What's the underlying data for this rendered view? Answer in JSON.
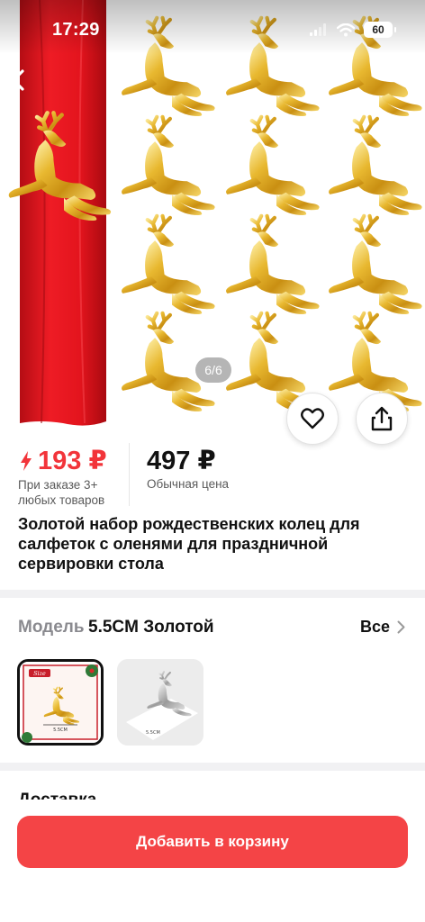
{
  "status_bar": {
    "time": "17:29",
    "battery": "60",
    "icons": [
      "signal-icon",
      "wifi-icon",
      "battery-icon"
    ]
  },
  "gallery": {
    "counter": "6/6",
    "image": "product-photo-golden-deer-napkin-rings",
    "actions": [
      "heart-icon",
      "share-icon"
    ]
  },
  "price": {
    "sale_price": "193 ₽",
    "sale_note_line1": "При заказе 3+",
    "sale_note_line2": "любых товаров",
    "regular_price": "497 ₽",
    "regular_note": "Обычная цена",
    "sale_color": "#f2343a"
  },
  "product": {
    "title": "Золотой набор рождественских колец для салфеток с оленями для праздничной сервировки стола"
  },
  "model": {
    "label": "Модель",
    "value": "5.5CM Золотой",
    "all_link": "Все",
    "variants": [
      {
        "name": "gold",
        "caption": "5.5CM",
        "selected": true
      },
      {
        "name": "silver",
        "caption": "5.5CM",
        "selected": false
      }
    ]
  },
  "delivery": {
    "title": "Доставка"
  },
  "cart": {
    "button_label": "Добавить в корзину",
    "color": "#f44446"
  }
}
